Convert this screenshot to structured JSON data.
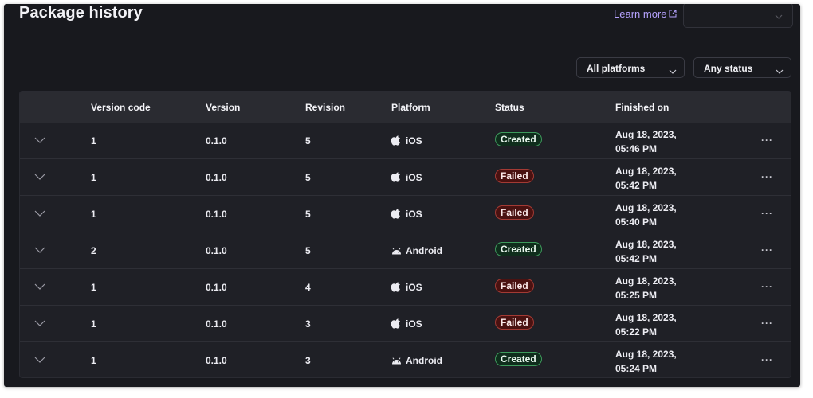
{
  "header": {
    "title": "Package history",
    "learn_more": "Learn more",
    "select_value": ""
  },
  "filters": {
    "platform": "All platforms",
    "status": "Any status"
  },
  "table": {
    "columns": [
      "Version code",
      "Version",
      "Revision",
      "Platform",
      "Status",
      "Finished on"
    ],
    "rows": [
      {
        "version_code": "1",
        "version": "0.1.0",
        "revision": "5",
        "platform": "iOS",
        "platform_icon": "apple-icon",
        "status": "Created",
        "finished_on": "Aug 18, 2023, 05:46 PM",
        "more": "···"
      },
      {
        "version_code": "1",
        "version": "0.1.0",
        "revision": "5",
        "platform": "iOS",
        "platform_icon": "apple-icon",
        "status": "Failed",
        "finished_on": "Aug 18, 2023, 05:42 PM",
        "more": "···"
      },
      {
        "version_code": "1",
        "version": "0.1.0",
        "revision": "5",
        "platform": "iOS",
        "platform_icon": "apple-icon",
        "status": "Failed",
        "finished_on": "Aug 18, 2023, 05:40 PM",
        "more": "···"
      },
      {
        "version_code": "2",
        "version": "0.1.0",
        "revision": "5",
        "platform": "Android",
        "platform_icon": "android-icon",
        "status": "Created",
        "finished_on": "Aug 18, 2023, 05:42 PM",
        "more": "···"
      },
      {
        "version_code": "1",
        "version": "0.1.0",
        "revision": "4",
        "platform": "iOS",
        "platform_icon": "apple-icon",
        "status": "Failed",
        "finished_on": "Aug 18, 2023, 05:25 PM",
        "more": "···"
      },
      {
        "version_code": "1",
        "version": "0.1.0",
        "revision": "3",
        "platform": "iOS",
        "platform_icon": "apple-icon",
        "status": "Failed",
        "finished_on": "Aug 18, 2023, 05:22 PM",
        "more": "···"
      },
      {
        "version_code": "1",
        "version": "0.1.0",
        "revision": "3",
        "platform": "Android",
        "platform_icon": "android-icon",
        "status": "Created",
        "finished_on": "Aug 18, 2023, 05:24 PM",
        "more": "···"
      }
    ]
  },
  "colors": {
    "background": "#18191e",
    "accent_link": "#b6a3ff",
    "status_created": "#3d9a5c",
    "status_failed": "#a33a34"
  }
}
